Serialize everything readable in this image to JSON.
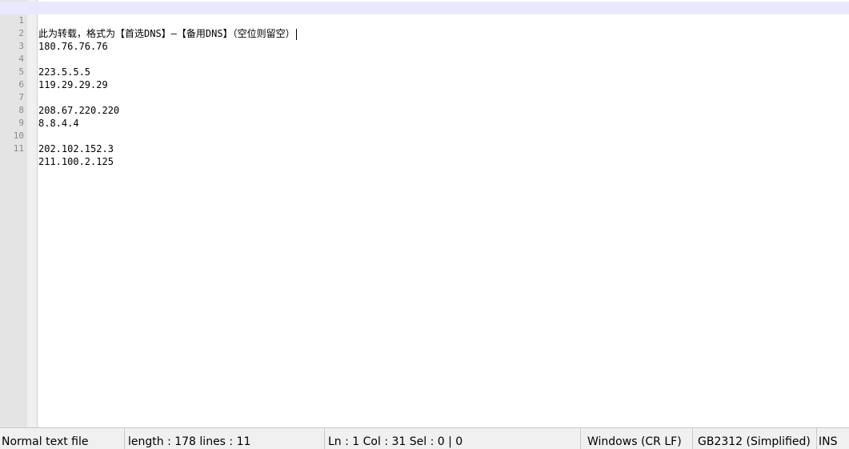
{
  "editor": {
    "lines": [
      {
        "num": "1",
        "text": "此为转载，格式为【首选DNS】—【备用DNS】（空位则留空）"
      },
      {
        "num": "2",
        "text": "180.76.76.76"
      },
      {
        "num": "3",
        "text": ""
      },
      {
        "num": "4",
        "text": "223.5.5.5"
      },
      {
        "num": "5",
        "text": "119.29.29.29"
      },
      {
        "num": "6",
        "text": ""
      },
      {
        "num": "7",
        "text": "208.67.220.220"
      },
      {
        "num": "8",
        "text": "8.8.4.4"
      },
      {
        "num": "9",
        "text": ""
      },
      {
        "num": "10",
        "text": "202.102.152.3"
      },
      {
        "num": "11",
        "text": "211.100.2.125"
      }
    ]
  },
  "statusbar": {
    "file_type": "Normal text file",
    "length_lines": "length : 178    lines : 11",
    "position": "Ln : 1    Col : 31    Sel : 0 | 0",
    "eol": "Windows (CR LF)",
    "encoding": "GB2312 (Simplified)",
    "mode": "INS"
  },
  "colors": {
    "gutter_bg": "#e4e4e4",
    "current_line_bg": "#e8e8ff",
    "statusbar_bg": "#f0f0f0"
  }
}
